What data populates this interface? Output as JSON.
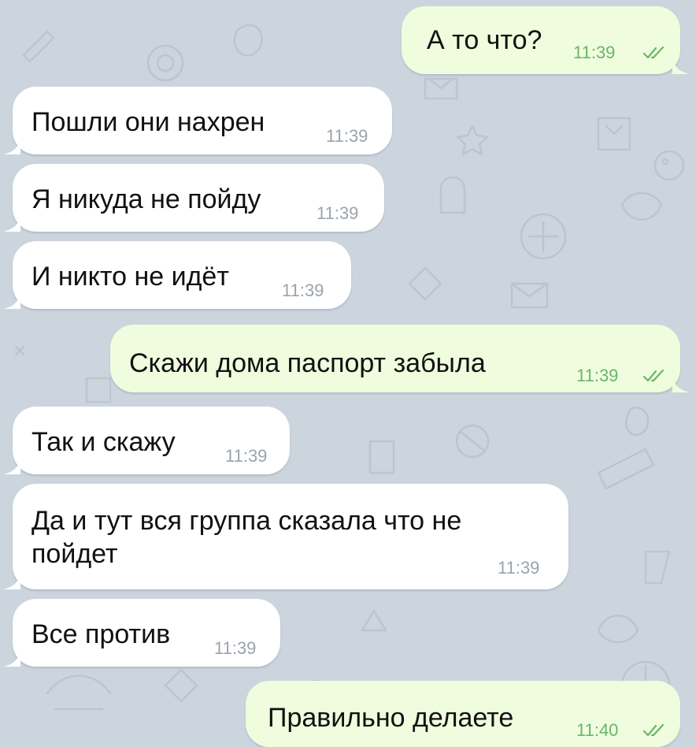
{
  "messages": [
    {
      "direction": "out",
      "text": "А то что?",
      "time": "11:39",
      "read": true
    },
    {
      "direction": "in",
      "text": "Пошли они нахрен",
      "time": "11:39"
    },
    {
      "direction": "in",
      "text": "Я никуда не пойду",
      "time": "11:39"
    },
    {
      "direction": "in",
      "text": "И никто не идёт",
      "time": "11:39"
    },
    {
      "direction": "out",
      "text": "Скажи дома паспорт забыла",
      "time": "11:39",
      "read": true
    },
    {
      "direction": "in",
      "text": "Так и скажу",
      "time": "11:39"
    },
    {
      "direction": "in",
      "text_line1": "Да и тут вся группа сказала что не",
      "text_line2": "пойдет",
      "time": "11:39"
    },
    {
      "direction": "in",
      "text": "Все против",
      "time": "11:39"
    },
    {
      "direction": "out",
      "text": "Правильно делаете",
      "time": "11:40",
      "read": true
    }
  ],
  "colors": {
    "background": "#ccd5de",
    "incoming_bubble": "#ffffff",
    "outgoing_bubble": "#effdde",
    "outgoing_time": "#6ab56a",
    "incoming_time": "#9aa4ac"
  },
  "icons": {
    "read_receipt": "double-check-icon",
    "wallpaper": "doodle-pattern-icon"
  }
}
